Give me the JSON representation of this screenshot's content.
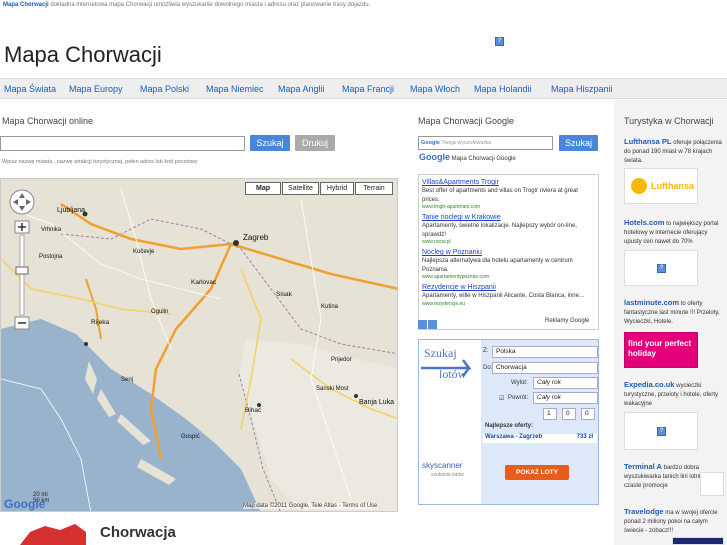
{
  "topline": {
    "brand": "Mapa Chorwacji",
    "text": "dokładna internetowa mapa Chorwacji umożliwia wyszukanie dowolnego miasta i adresu oraz planowanie trasy dojazdu."
  },
  "site_title": "Mapa Chorwacji",
  "nav": {
    "items": [
      "Mapa Świata",
      "Mapa Europy",
      "Mapa Polski",
      "Mapa Niemiec",
      "Mapa Anglii",
      "Mapa Francji",
      "Mapa Włoch",
      "Mapa Holandii",
      "Mapa Hiszpanii"
    ]
  },
  "main": {
    "heading": "Mapa Chorwacji online",
    "search_placeholder": "",
    "search_button": "Szukaj",
    "route_button": "Drukuj",
    "hint": "Wpisz nazwę miasta, ,nazwę atrakcji turystycznej, pełen adres lub kod pocztowy",
    "map": {
      "types": [
        "Map",
        "Satellite",
        "Hybrid",
        "Terrain"
      ],
      "active_type": "Map",
      "cities": [
        "Ljubljana",
        "Zagreb",
        "Rijeka",
        "Banja Luka",
        "Bihać",
        "Sanski Most",
        "Prijedor",
        "Kočevje",
        "Vrhnika",
        "Postojna",
        "Senj",
        "Gospić",
        "Ogulin",
        "Karlovac",
        "Sisak",
        "Kutina"
      ],
      "scale": [
        "20 mi",
        "50 km"
      ],
      "logo": "Google",
      "footer": "Map data ©2011 Google, Tele Atlas - Terms of Use"
    },
    "country_heading": "Chorwacja"
  },
  "google_ads": {
    "heading": "Mapa Chorwacji Google",
    "search_placeholder": "Twoja wyszukiwarka",
    "search_button": "Szukaj",
    "brand": "Google",
    "brand_suffix": "Mapa Chorwacji Google",
    "ads": [
      {
        "title": "Villas&Apartments Trogir",
        "desc": "Best offer of apartments and villas on Trogir riviera at great prices.",
        "url": "www.trogir-apartmani.com"
      },
      {
        "title": "Tanie noclegi w Krakowie",
        "desc": "Apartamenty, świetne lokalizacje. Najlepszy wybór on-line, sprawdź!",
        "url": "www.nocw.pl"
      },
      {
        "title": "Nocleg w Poznaniu",
        "desc": "Najlepsza alternatywa dla hotelu apartamenty w centrum Poznania.",
        "url": "www.apartamentypoznan.com"
      },
      {
        "title": "Rezydencje w Hiszpanii",
        "desc": "Apartamenty, wille w Hiszpanii Alicante, Costa Blanca, inne...",
        "url": "www.rezydencje.eu"
      }
    ],
    "ads_by": "Reklamy Google"
  },
  "flight": {
    "big1": "Szukaj",
    "big2": "lotów",
    "from_label": "Z:",
    "from_value": "Polska",
    "to_label": "Do:",
    "to_value": "Chorwacja",
    "depart_label": "Wylot:",
    "depart_value": "Cały rok",
    "return_label": "Powrót:",
    "return_value": "Cały rok",
    "passengers": [
      "1",
      "0",
      "0"
    ],
    "best_label": "Najlepsze oferty:",
    "best_route": "Warszawa - Zagrzeb",
    "best_price": "733 zł",
    "brand": "skyscanner",
    "brand_sub": "szukanie lotów",
    "button": "POKAŻ LOTY"
  },
  "sidebar": {
    "heading": "Turystyka w Chorwacji",
    "ads": [
      {
        "name": "Lufthansa PL",
        "text": "oferuje połączenia do ponad 190 miast w 78 krajach świata.",
        "logo": "Lufthansa"
      },
      {
        "name": "Hotels.com",
        "text": "to największy portal hotelowy w internecie oferujący upusty cen nawet do 70%"
      },
      {
        "name": "lastminute.com",
        "text": "to oferty fantastyczne last minute !!! Przeloty, Wycieczki, Hotele.",
        "logo": "find your perfect holiday"
      },
      {
        "name": "Expedia.co.uk",
        "text": "wycieczki turystyczne, przeloty i hotele, oferty wakacyjne"
      },
      {
        "name": "Terminal A",
        "text": "bardzo dobra wyszukiwarka tanich lini lotniczych, czaste promocje"
      },
      {
        "name": "Travelodge",
        "text": "ma w swojej ofercie ponad 2 miliony pokoi na całym świecie - zobacz!!!"
      }
    ]
  }
}
